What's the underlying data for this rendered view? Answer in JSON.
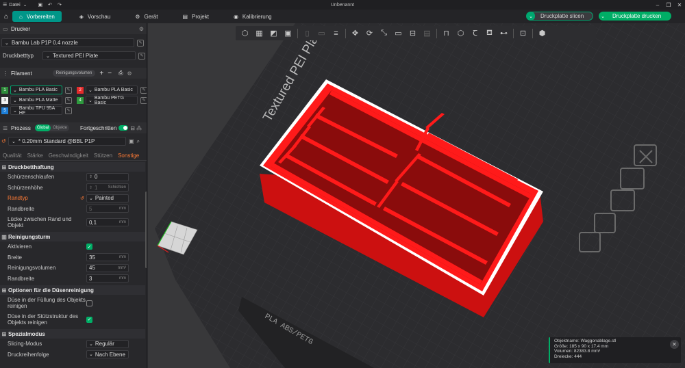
{
  "titlebar": {
    "menu": "Datei",
    "window_title": "Unbenannt"
  },
  "nav": {
    "tabs": [
      {
        "label": "Vorbereiten",
        "active": true
      },
      {
        "label": "Vorschau"
      },
      {
        "label": "Gerät"
      },
      {
        "label": "Projekt"
      },
      {
        "label": "Kalibrierung"
      }
    ],
    "slice_button": "Druckplatte slicen",
    "print_button": "Druckplatte drucken"
  },
  "printer": {
    "heading": "Drucker",
    "model": "Bambu Lab P1P 0.4 nozzle",
    "bed_label": "Druckbetttyp",
    "bed_value": "Textured PEI Plate"
  },
  "filament": {
    "heading": "Filament",
    "flush_button": "Reinigungsvolumen",
    "slots": [
      {
        "num": "1",
        "name": "Bambu PLA Basic",
        "color": "#2e8b3a"
      },
      {
        "num": "2",
        "name": "Bambu PLA Basic",
        "color": "#e52b2b"
      },
      {
        "num": "3",
        "name": "Bambu PLA Matte",
        "color": "#f2f2f2"
      },
      {
        "num": "4",
        "name": "Bambu PETG Basic",
        "color": "#2e9a3e"
      },
      {
        "num": "5",
        "name": "Bambu TPU 95A HF",
        "color": "#1e7fd8"
      }
    ]
  },
  "process": {
    "heading": "Prozess",
    "toggle_global": "Global",
    "toggle_object": "Objekte",
    "advanced_label": "Fortgeschritten",
    "preset": "* 0.20mm Standard @BBL P1P",
    "tabs": [
      "Qualität",
      "Stärke",
      "Geschwindigkeit",
      "Stützen",
      "Sonstige"
    ],
    "active_tab": "Sonstige"
  },
  "groups": {
    "bed_adhesion": {
      "title": "Druckbetthaftung",
      "skirt_loops": {
        "label": "Schürzenschlaufen",
        "value": "0"
      },
      "skirt_height": {
        "label": "Schürzenhöhe",
        "value": "1",
        "unit": "Schichten"
      },
      "brim_type": {
        "label": "Randtyp",
        "value": "Painted"
      },
      "brim_width": {
        "label": "Randbreite",
        "value": "5",
        "unit": "mm"
      },
      "brim_gap": {
        "label": "Lücke zwischen Rand und Objekt",
        "value": "0,1",
        "unit": "mm"
      }
    },
    "prime_tower": {
      "title": "Reinigungsturm",
      "enable": {
        "label": "Aktivieren"
      },
      "width": {
        "label": "Breite",
        "value": "35",
        "unit": "mm"
      },
      "volume": {
        "label": "Reinigungsvolumen",
        "value": "45",
        "unit": "mm³"
      },
      "brim": {
        "label": "Randbreite",
        "value": "3",
        "unit": "mm"
      }
    },
    "flush": {
      "title": "Optionen für die Düsenreinigung",
      "infill": {
        "label": "Düse in der Füllung des Objekts reinigen"
      },
      "support": {
        "label": "Düse in der Stützstruktur des Objekts reinigen"
      }
    },
    "special": {
      "title": "Spezialmodus",
      "slicing_mode": {
        "label": "Slicing-Modus",
        "value": "Regulär"
      },
      "print_order": {
        "label": "Druckreihenfolge",
        "value": "Nach Ebene"
      }
    }
  },
  "plate": {
    "bed_label": "Textured PEI Plate",
    "sticker": "PLA ABS/PETG",
    "model_color": "#ff1a1a"
  },
  "object_info": {
    "name": "Objektname: Waggonablage.stl",
    "size": "Größe: 185 x 90 x 17.4 mm",
    "volume": "Volumen: 82383.8 mm³",
    "triangles": "Dreiecke: 444"
  }
}
